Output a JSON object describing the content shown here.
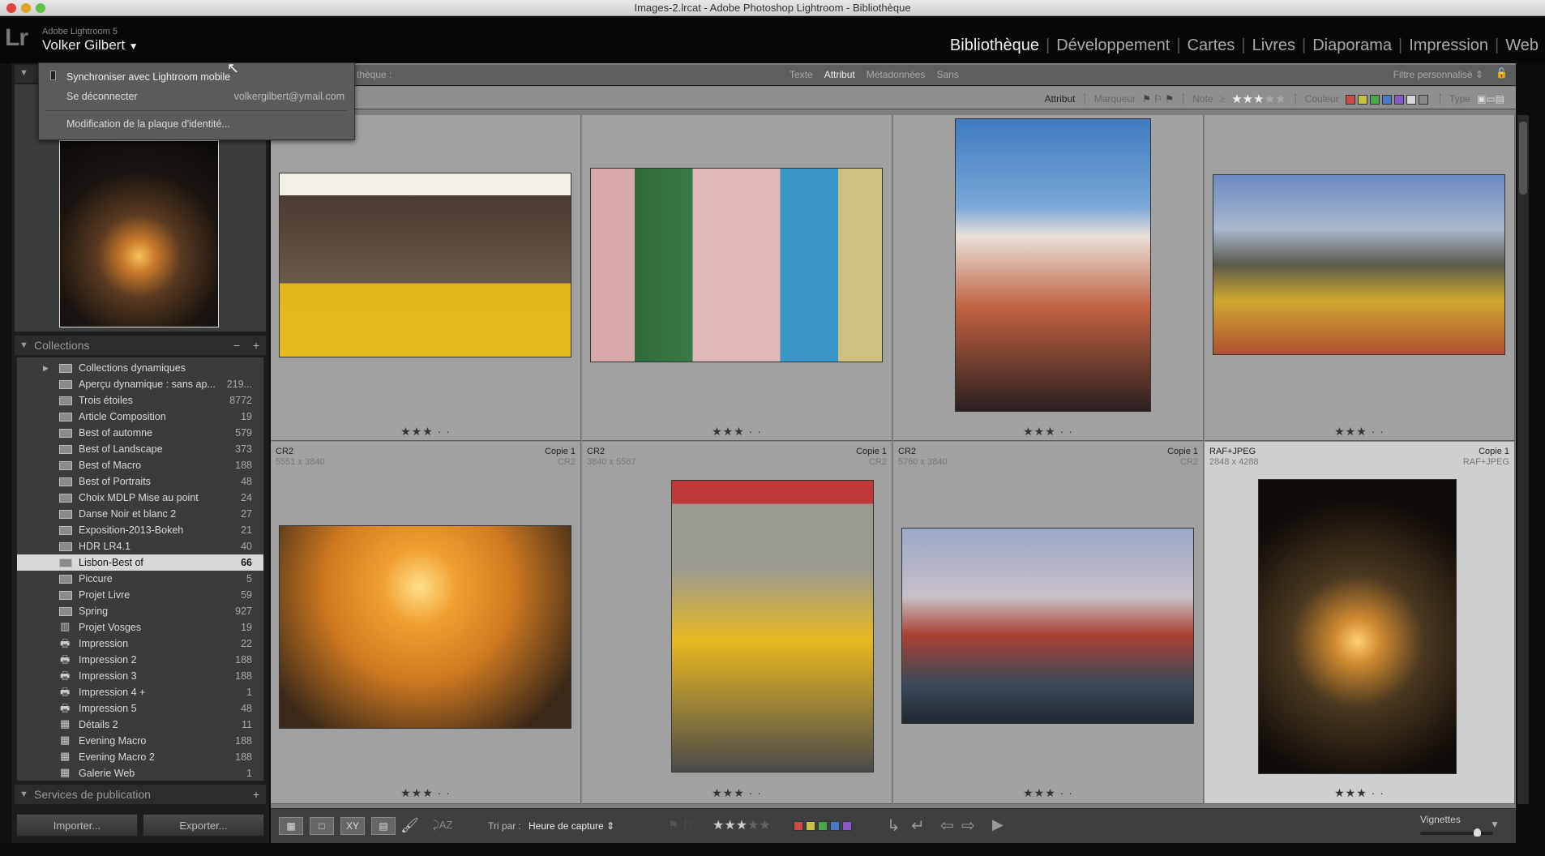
{
  "window": {
    "title": "Images-2.lrcat - Adobe Photoshop Lightroom - Bibliothèque"
  },
  "identity": {
    "logo": "Lr",
    "product": "Adobe Lightroom 5",
    "user": "Volker Gilbert"
  },
  "modules": [
    {
      "label": "Bibliothèque",
      "active": true
    },
    {
      "label": "Développement"
    },
    {
      "label": "Cartes"
    },
    {
      "label": "Livres"
    },
    {
      "label": "Diaporama"
    },
    {
      "label": "Impression"
    },
    {
      "label": "Web"
    }
  ],
  "identity_menu": {
    "sync": "Synchroniser avec Lightroom mobile",
    "logout": "Se déconnecter",
    "email": "volkergilbert@ymail.com",
    "edit_plate": "Modification de la plaque d'identité..."
  },
  "filter_bar": {
    "label": "thèque :",
    "tabs": [
      "Texte",
      "Attribut",
      "Métadonnées",
      "Sans"
    ],
    "active_tab": "Attribut",
    "preset": "Filtre personnalisé"
  },
  "attribute_bar": {
    "label": "Attribut",
    "flag_label": "Marqueur",
    "rating_label": "Note",
    "rating_op": "≥",
    "rating": 3,
    "color_label": "Couleur",
    "type_label": "Type",
    "colors": [
      "#d04848",
      "#c8c040",
      "#48a848",
      "#4878c8",
      "#8858c8",
      "#d8d8d8",
      "#888888"
    ]
  },
  "collections": {
    "title": "Collections",
    "items": [
      {
        "name": "Collections dynamiques",
        "count": "",
        "icon": "collection-set",
        "expand": true
      },
      {
        "name": "Aperçu dynamique : sans ap...",
        "count": "219...",
        "icon": "smart"
      },
      {
        "name": "Trois étoiles",
        "count": "8772",
        "icon": "smart"
      },
      {
        "name": "Article Composition",
        "count": "19",
        "icon": "collection"
      },
      {
        "name": "Best of automne",
        "count": "579",
        "icon": "collection"
      },
      {
        "name": "Best of Landscape",
        "count": "373",
        "icon": "collection"
      },
      {
        "name": "Best of Macro",
        "count": "188",
        "icon": "collection"
      },
      {
        "name": "Best of Portraits",
        "count": "48",
        "icon": "collection"
      },
      {
        "name": "Choix MDLP Mise au point",
        "count": "24",
        "icon": "collection"
      },
      {
        "name": "Danse Noir et blanc 2",
        "count": "27",
        "icon": "collection"
      },
      {
        "name": "Exposition-2013-Bokeh",
        "count": "21",
        "icon": "collection"
      },
      {
        "name": "HDR LR4.1",
        "count": "40",
        "icon": "collection"
      },
      {
        "name": "Lisbon-Best of",
        "count": "66",
        "icon": "collection",
        "selected": true
      },
      {
        "name": "Piccure",
        "count": "5",
        "icon": "collection"
      },
      {
        "name": "Projet Livre",
        "count": "59",
        "icon": "collection"
      },
      {
        "name": "Spring",
        "count": "927",
        "icon": "collection"
      },
      {
        "name": "Projet Vosges",
        "count": "19",
        "icon": "book"
      },
      {
        "name": "Impression",
        "count": "22",
        "icon": "print"
      },
      {
        "name": "Impression  2",
        "count": "188",
        "icon": "print"
      },
      {
        "name": "Impression  3",
        "count": "188",
        "icon": "print"
      },
      {
        "name": "Impression  4 +",
        "count": "1",
        "icon": "print"
      },
      {
        "name": "Impression  5",
        "count": "48",
        "icon": "print"
      },
      {
        "name": "Détails 2",
        "count": "11",
        "icon": "web"
      },
      {
        "name": "Evening Macro",
        "count": "188",
        "icon": "web"
      },
      {
        "name": "Evening Macro 2",
        "count": "188",
        "icon": "web"
      },
      {
        "name": "Galerie Web",
        "count": "1",
        "icon": "web"
      }
    ]
  },
  "publish": {
    "title": "Services de publication"
  },
  "buttons": {
    "import": "Importer...",
    "export": "Exporter..."
  },
  "grid": {
    "row1": [
      {
        "rating": 3
      },
      {
        "rating": 3
      },
      {
        "rating": 3
      },
      {
        "rating": 3
      }
    ],
    "row2": [
      {
        "format": "CR2",
        "copy": "Copie 1",
        "dims": "5551 x 3840",
        "ext": "CR2",
        "rating": 3
      },
      {
        "format": "CR2",
        "copy": "Copie 1",
        "dims": "3840 x 5567",
        "ext": "CR2",
        "rating": 3
      },
      {
        "format": "CR2",
        "copy": "Copie 1",
        "dims": "5760 x 3840",
        "ext": "CR2",
        "rating": 3
      },
      {
        "format": "RAF+JPEG",
        "copy": "Copie 1",
        "dims": "2848 x 4288",
        "ext": "RAF+JPEG",
        "rating": 3,
        "selected": true
      }
    ]
  },
  "toolbar": {
    "sort_label": "Tri par :",
    "sort_value": "Heure de capture",
    "rating": 3,
    "colors": [
      "#d04848",
      "#c8c040",
      "#48a848",
      "#4878c8",
      "#8858c8"
    ],
    "thumbs_label": "Vignettes",
    "thumb_size": 0.78
  }
}
